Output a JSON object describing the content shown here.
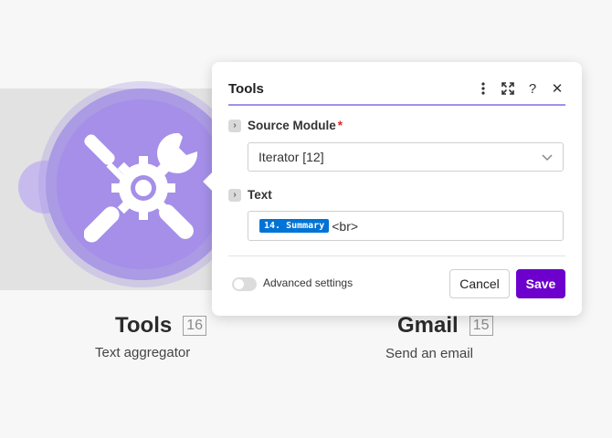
{
  "canvas": {
    "modules": [
      {
        "title": "Tools",
        "number": "16",
        "subtitle": "Text aggregator"
      },
      {
        "title": "Gmail",
        "number": "15",
        "subtitle": "Send an email"
      }
    ],
    "tools_icon": "wrench-screwdriver-gear-icon"
  },
  "dialog": {
    "title": "Tools",
    "header_icons": [
      "more-vertical-icon",
      "expand-icon",
      "help-icon",
      "close-icon"
    ],
    "help_glyph": "?",
    "close_glyph": "✕",
    "expand_glyph": "›",
    "source_module": {
      "label": "Source Module",
      "required_mark": "*",
      "value": "Iterator [12]"
    },
    "text_field": {
      "label": "Text",
      "pill": "14. Summary",
      "tail": "<br>"
    },
    "advanced_settings_label": "Advanced settings",
    "advanced_settings_on": false,
    "cancel_label": "Cancel",
    "save_label": "Save"
  },
  "colors": {
    "accent_purple": "#6d00cc",
    "node_purple": "#a58fe8",
    "pill_blue": "#0073d6",
    "required_red": "#e02424"
  }
}
